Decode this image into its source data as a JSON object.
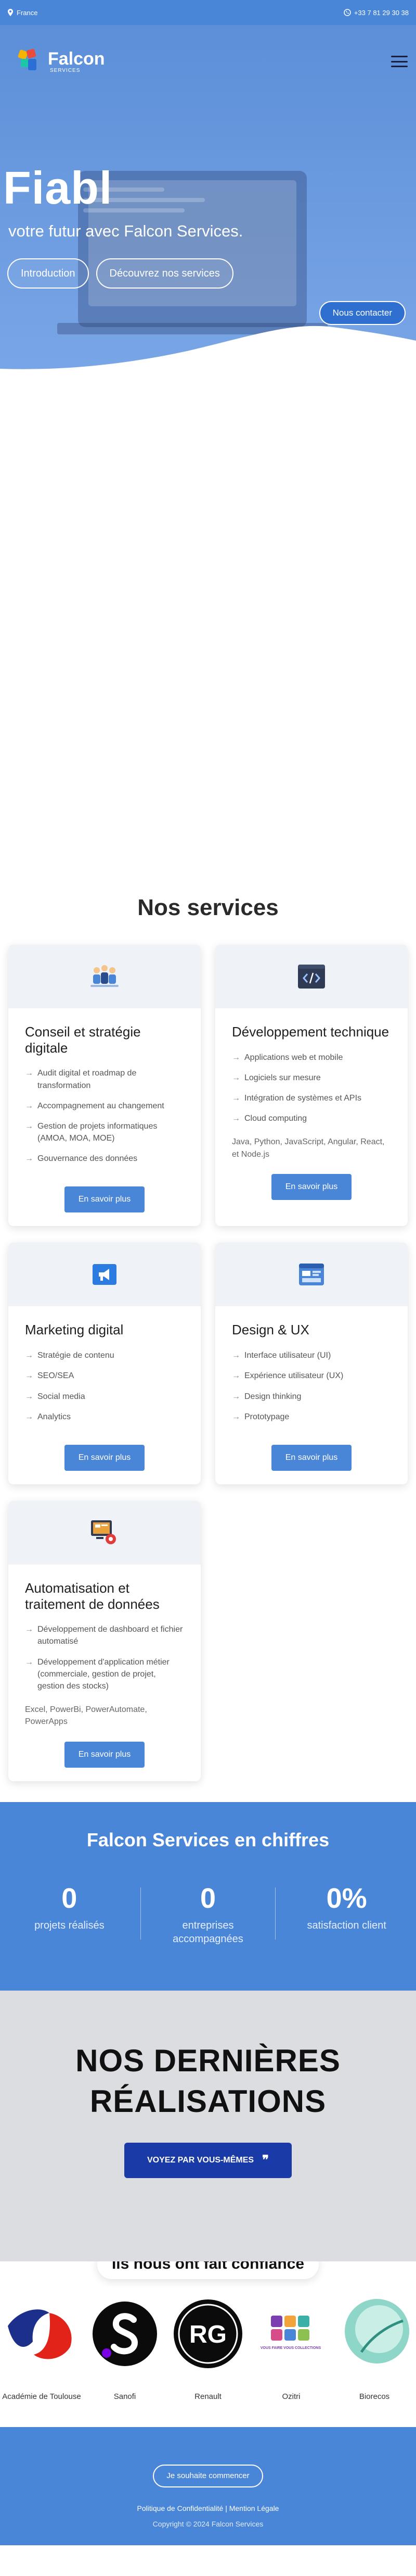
{
  "topbar": {
    "location": "France",
    "phone": "+33 7 81 29 30 38"
  },
  "brand": {
    "name": "Falcon",
    "tagline": "SERVICES"
  },
  "hero": {
    "title": "Fiabl",
    "subtitle": "votre futur avec Falcon Services.",
    "btn_intro": "Introduction",
    "btn_services": "Découvrez nos services",
    "btn_contact": "Nous contacter"
  },
  "services": {
    "title": "Nos services",
    "cards": [
      {
        "title": "Conseil et stratégie digitale",
        "icon": "team-strategy-icon",
        "items": [
          "Audit digital et roadmap de transformation",
          "Accompagnement au changement",
          "Gestion de projets informatiques (AMOA, MOA, MOE)",
          "Gouvernance des données"
        ],
        "tech": "",
        "button": "En savoir plus"
      },
      {
        "title": "Développement technique",
        "icon": "code-icon",
        "items": [
          "Applications web et mobile",
          "Logiciels sur mesure",
          "Intégration de systèmes et APIs",
          "Cloud computing"
        ],
        "tech": "Java, Python, JavaScript, Angular, React, et Node.js",
        "button": "En savoir plus"
      },
      {
        "title": "Marketing digital",
        "icon": "megaphone-icon",
        "items": [
          "Stratégie de contenu",
          "SEO/SEA",
          "Social media",
          "Analytics"
        ],
        "tech": "",
        "button": "En savoir plus"
      },
      {
        "title": "Design & UX",
        "icon": "design-window-icon",
        "items": [
          "Interface utilisateur (UI)",
          "Expérience utilisateur (UX)",
          "Design thinking",
          "Prototypage"
        ],
        "tech": "",
        "button": "En savoir plus"
      },
      {
        "title": "Automatisation et traitement de données",
        "icon": "automation-gear-icon",
        "items": [
          "Développement de dashboard et fichier automatisé",
          "Développement d'application métier (commerciale, gestion de projet, gestion des stocks)"
        ],
        "tech": "Excel, PowerBi, PowerAutomate, PowerApps",
        "button": "En savoir plus"
      }
    ]
  },
  "stats": {
    "title": "Falcon Services en chiffres",
    "items": [
      {
        "value": "0",
        "label": "projets réalisés"
      },
      {
        "value": "0",
        "label": "entreprises accompagnées"
      },
      {
        "value": "0%",
        "label": "satisfaction client"
      }
    ]
  },
  "realisations": {
    "title_line1": "NOS DERNIÈRES",
    "title_line2": "RÉALISATIONS",
    "button": "VOYEZ PAR VOUS-MÊMES",
    "button_icon": "quote-icon"
  },
  "clients": {
    "title": "Ils nous ont fait confiance",
    "logos": [
      {
        "name": "Académie de Toulouse"
      },
      {
        "name": "Sanofi"
      },
      {
        "name": "Renault",
        "mark": "RG"
      },
      {
        "name": "Ozitri",
        "mark": "VOUS FAIRE VOUS COLLECTIONS"
      },
      {
        "name": "Biorecos"
      }
    ]
  },
  "footer": {
    "cta": "Je souhaite commencer",
    "links": "Politique de Confidentialité | Mention Légale",
    "copyright": "Copyright © 2024 Falcon Services"
  },
  "colors": {
    "primary": "#4a86d8",
    "dark_button": "#1a3aa8",
    "gray_section": "#dcdde0"
  }
}
